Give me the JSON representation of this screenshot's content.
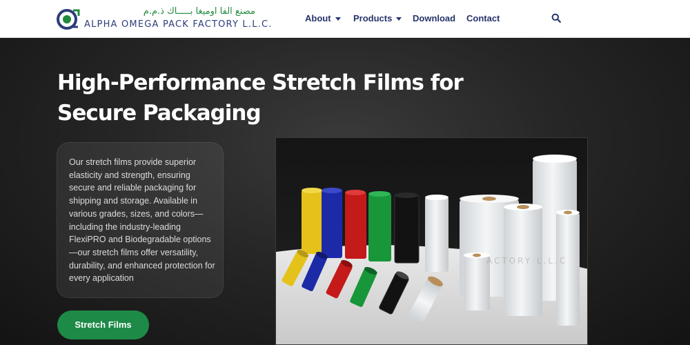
{
  "brand": {
    "arabic_name": "مصنع الفا اوميغا بـــــاك ذ.م.م",
    "english_name": "ALPHA OMEGA PACK FACTORY L.L.C."
  },
  "nav": {
    "items": [
      {
        "label": "About",
        "has_dropdown": true
      },
      {
        "label": "Products",
        "has_dropdown": true
      },
      {
        "label": "Download",
        "has_dropdown": false
      },
      {
        "label": "Contact",
        "has_dropdown": false
      }
    ],
    "search_icon": "search-icon"
  },
  "hero": {
    "title_line1": "High-Performance Stretch Films for",
    "title_line2": "Secure Packaging",
    "description": "Our stretch films provide superior elasticity and strength, ensuring secure and reliable packaging for shipping and storage. Available in various grades, sizes, and colors—including the industry-leading FlexiPRO and Biodegradable options—our stretch films offer versatility, durability, and enhanced protection for every application",
    "cta_label": "Stretch Films"
  },
  "colors": {
    "brand_navy": "#26336b",
    "brand_green": "#1d8a47",
    "hero_bg": "#262626"
  }
}
